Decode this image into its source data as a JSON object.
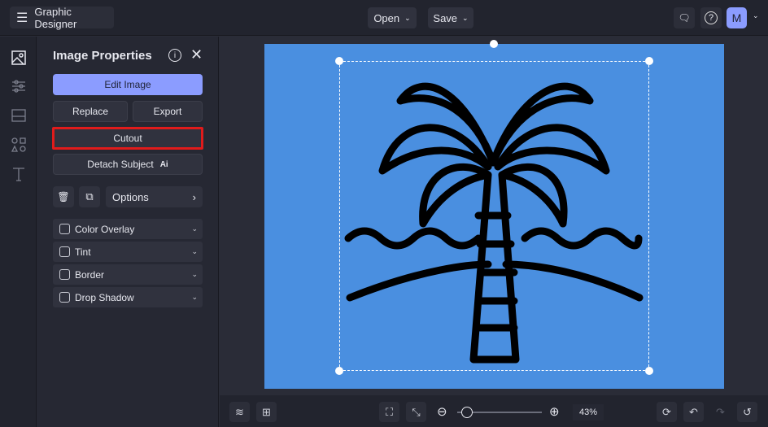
{
  "app": {
    "title": "Graphic Designer",
    "menu_open": "Open",
    "menu_save": "Save",
    "avatar": "M"
  },
  "panel": {
    "title": "Image Properties",
    "edit_image": "Edit Image",
    "replace": "Replace",
    "export": "Export",
    "cutout": "Cutout",
    "detach_subject": "Detach Subject",
    "ai_badge": "Ai",
    "options": "Options",
    "accordions": [
      {
        "label": "Color Overlay"
      },
      {
        "label": "Tint"
      },
      {
        "label": "Border"
      },
      {
        "label": "Drop Shadow"
      }
    ]
  },
  "zoom": {
    "value": "43%",
    "fraction": 0.43
  },
  "colors": {
    "canvas": "#4a8fe0",
    "accent": "#8b9cff",
    "highlight": "#e01b1b"
  }
}
